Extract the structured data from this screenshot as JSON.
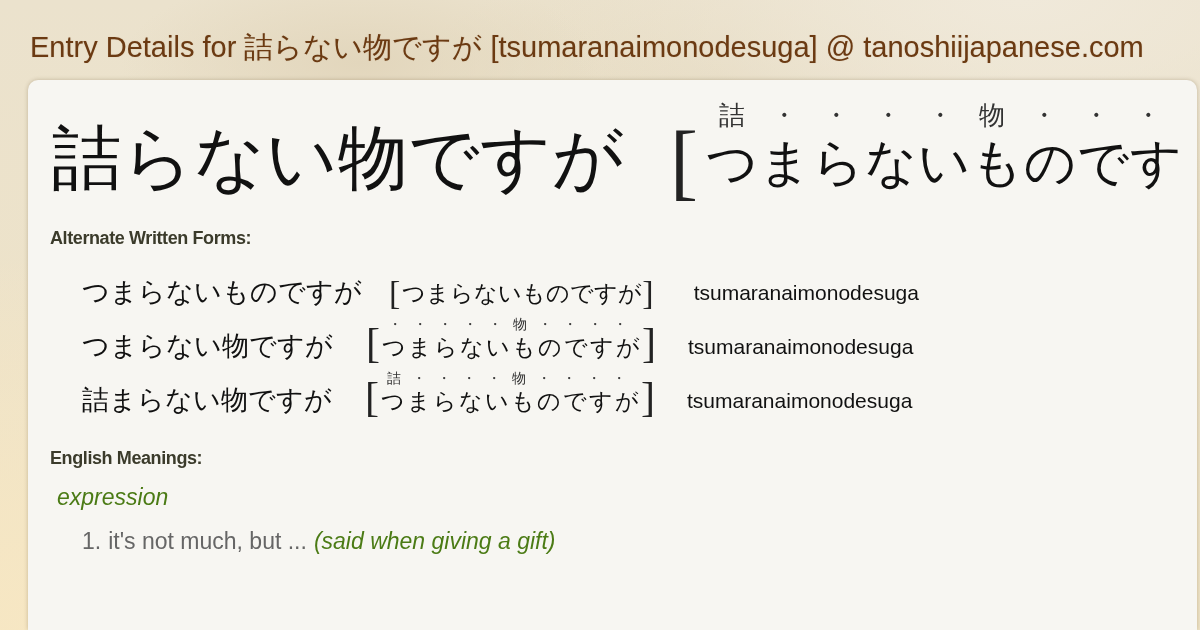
{
  "page_title": "Entry Details for 詰らない物ですが [tsumaranaimonodesuga] @ tanoshiijapanese.com",
  "entry": {
    "word": "詰らない物ですが",
    "bracket_open": "[",
    "reading": "つまらないものです",
    "furigana": [
      "詰",
      "・",
      "・",
      "・",
      "・",
      "物",
      "・",
      "・",
      "・"
    ]
  },
  "alternate_forms": {
    "heading": "Alternate Written Forms:",
    "forms": [
      {
        "written": "つまらないものですが",
        "bracket_open": "[",
        "reading": "つまらないものですが",
        "bracket_close": "]",
        "romaji": "tsumaranaimonodesuga"
      },
      {
        "written": "つまらない物ですが",
        "bracket_open": "[",
        "reading": "つまらないものですが",
        "furigana": [
          "・",
          "・",
          "・",
          "・",
          "・",
          "物",
          "・",
          "・",
          "・",
          "・"
        ],
        "bracket_close": "]",
        "romaji": "tsumaranaimonodesuga"
      },
      {
        "written": "詰まらない物ですが",
        "bracket_open": "[",
        "reading": "つまらないものですが",
        "furigana": [
          "詰",
          "・",
          "・",
          "・",
          "・",
          "物",
          "・",
          "・",
          "・",
          "・"
        ],
        "bracket_close": "]",
        "romaji": "tsumaranaimonodesuga"
      }
    ]
  },
  "meanings": {
    "heading": "English Meanings:",
    "part_of_speech": "expression",
    "senses": [
      {
        "number": "1.",
        "gloss": "it's not much, but ...",
        "note": "(said when giving a gift)"
      }
    ]
  }
}
